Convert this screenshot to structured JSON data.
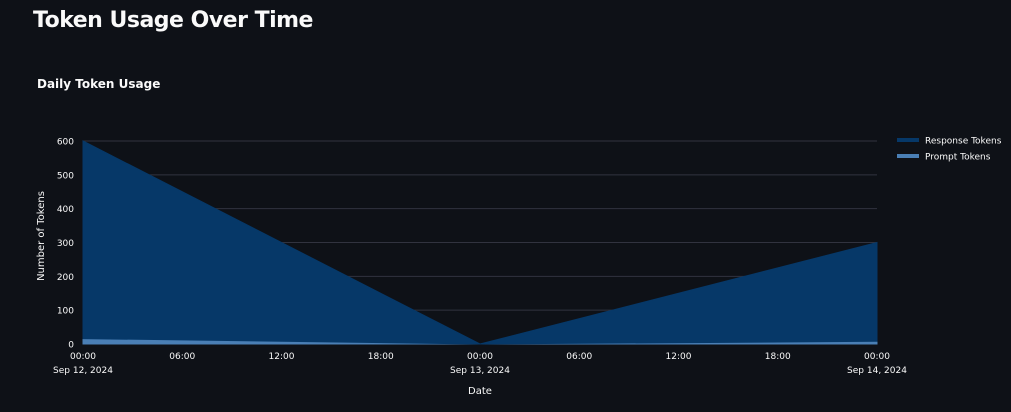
{
  "page": {
    "title": "Token Usage Over Time"
  },
  "chart_data": {
    "type": "area",
    "stacked": true,
    "title": "Daily Token Usage",
    "xlabel": "Date",
    "ylabel": "Number of Tokens",
    "x": [
      "2024-09-12",
      "2024-09-13",
      "2024-09-14"
    ],
    "x_ticks": [
      {
        "label": "00:00",
        "sublabel": "Sep 12, 2024",
        "value": 0
      },
      {
        "label": "06:00",
        "sublabel": "",
        "value": 0.25
      },
      {
        "label": "12:00",
        "sublabel": "",
        "value": 0.5
      },
      {
        "label": "18:00",
        "sublabel": "",
        "value": 0.75
      },
      {
        "label": "00:00",
        "sublabel": "Sep 13, 2024",
        "value": 1
      },
      {
        "label": "06:00",
        "sublabel": "",
        "value": 1.25
      },
      {
        "label": "12:00",
        "sublabel": "",
        "value": 1.5
      },
      {
        "label": "18:00",
        "sublabel": "",
        "value": 1.75
      },
      {
        "label": "00:00",
        "sublabel": "Sep 14, 2024",
        "value": 2
      }
    ],
    "y_ticks": [
      0,
      100,
      200,
      300,
      400,
      500,
      600
    ],
    "ylim": [
      0,
      600
    ],
    "grid": true,
    "legend_position": "right",
    "series": [
      {
        "name": "Prompt Tokens",
        "color": "#4a7fb5",
        "values": [
          16,
          0,
          8
        ]
      },
      {
        "name": "Response Tokens",
        "color": "#063868",
        "values": [
          584,
          0,
          292
        ]
      }
    ],
    "legend_order": [
      "Response Tokens",
      "Prompt Tokens"
    ],
    "colors": {
      "background": "#0e1117",
      "grid": "#31333f",
      "text": "#fafafa"
    }
  }
}
